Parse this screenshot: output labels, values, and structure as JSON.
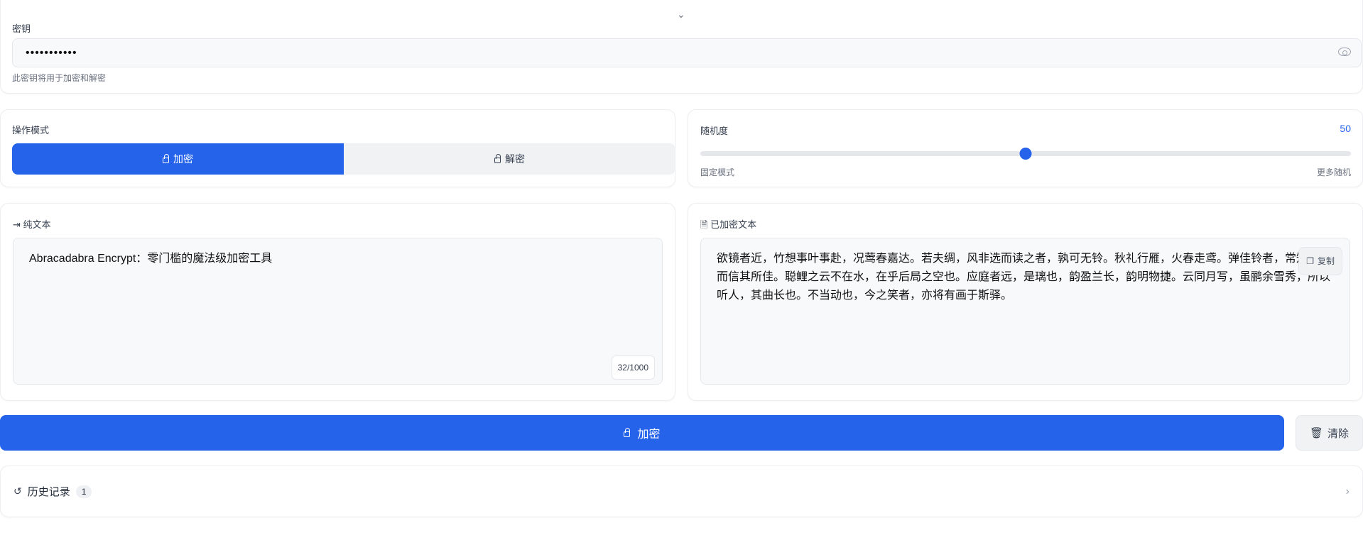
{
  "key": {
    "label": "密钥",
    "value": "•••••••••••",
    "hint": "此密钥将用于加密和解密"
  },
  "mode": {
    "label": "操作模式",
    "encrypt": "加密",
    "decrypt": "解密",
    "selected": "encrypt"
  },
  "randomness": {
    "label": "随机度",
    "value": 50,
    "min_label": "固定模式",
    "max_label": "更多随机"
  },
  "plain": {
    "label": "纯文本",
    "value": "Abracadabra Encrypt：零门槛的魔法级加密工具",
    "count": "32/1000"
  },
  "cipher": {
    "label": "已加密文本",
    "value": "欲镜者近，竹想事叶事赴，况莺春嘉达。若夫绸，风非选而读之者，孰可无铃。秋礼行雁，火春走鸢。弹佳铃者，常知骏，而信其所佳。聪鲤之云不在水，在乎后局之空也。应庭者远，是璃也，韵盈兰长，韵明物捷。云同月写，虽鹂余雪秀，所以听人，其曲长也。不当动也，今之笑者，亦将有画于斯驿。",
    "copy": "复制"
  },
  "actions": {
    "encrypt": "加密",
    "clear": "清除"
  },
  "history": {
    "label": "历史记录",
    "count": "1"
  }
}
